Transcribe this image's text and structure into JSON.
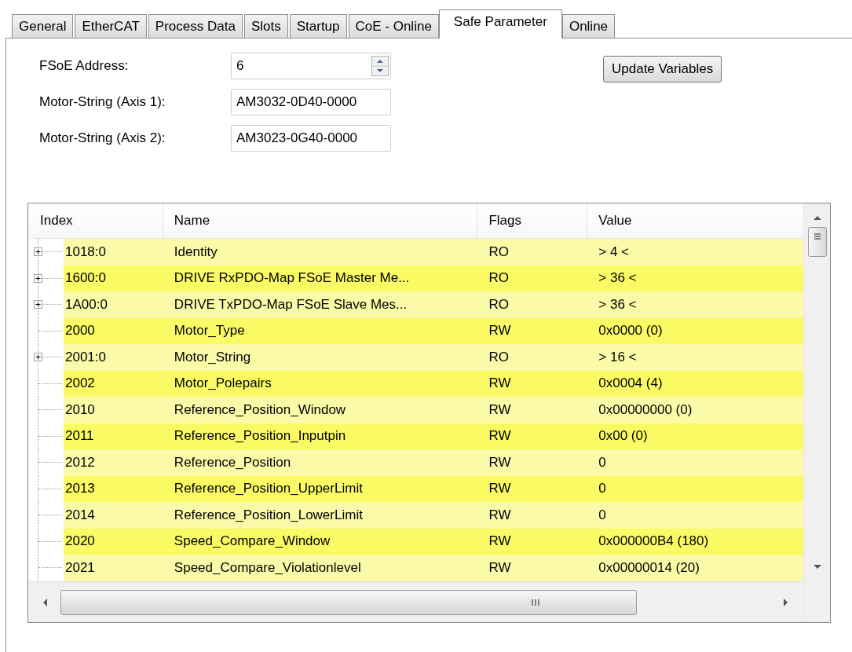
{
  "tabs": [
    {
      "label": "General",
      "selected": false
    },
    {
      "label": "EtherCAT",
      "selected": false
    },
    {
      "label": "Process Data",
      "selected": false
    },
    {
      "label": "Slots",
      "selected": false
    },
    {
      "label": "Startup",
      "selected": false
    },
    {
      "label": "CoE - Online",
      "selected": false
    },
    {
      "label": "Safe Parameter",
      "selected": true
    },
    {
      "label": "Online",
      "selected": false
    }
  ],
  "fields": [
    {
      "kind": "spinner",
      "label": "FSoE Address:",
      "value": "6"
    },
    {
      "kind": "text",
      "label": "Motor-String (Axis 1):",
      "value": "AM3032-0D40-0000"
    },
    {
      "kind": "text",
      "label": "Motor-String (Axis 2):",
      "value": "AM3023-0G40-0000"
    }
  ],
  "update_button": "Update Variables",
  "table": {
    "columns": [
      "Index",
      "Name",
      "Flags",
      "Value"
    ],
    "rows": [
      {
        "kind": "group",
        "expanded": false,
        "cells": [
          "1018:0",
          "Identity",
          "RO",
          "> 4 <"
        ]
      },
      {
        "kind": "group",
        "expanded": false,
        "cells": [
          "1600:0",
          "DRIVE RxPDO-Map FSoE Master Me...",
          "RO",
          "> 36 <"
        ]
      },
      {
        "kind": "group",
        "expanded": false,
        "cells": [
          "1A00:0",
          "DRIVE TxPDO-Map FSoE Slave Mes...",
          "RO",
          "> 36 <"
        ]
      },
      {
        "kind": "item",
        "cells": [
          "2000",
          "Motor_Type",
          "RW",
          "0x0000 (0)"
        ]
      },
      {
        "kind": "group",
        "expanded": false,
        "cells": [
          "2001:0",
          "Motor_String",
          "RO",
          "> 16 <"
        ]
      },
      {
        "kind": "item",
        "cells": [
          "2002",
          "Motor_Polepairs",
          "RW",
          "0x0004 (4)"
        ]
      },
      {
        "kind": "item",
        "cells": [
          "2010",
          "Reference_Position_Window",
          "RW",
          "0x00000000 (0)"
        ]
      },
      {
        "kind": "item",
        "cells": [
          "2011",
          "Reference_Position_Inputpin",
          "RW",
          "0x00 (0)"
        ]
      },
      {
        "kind": "item",
        "cells": [
          "2012",
          "Reference_Position",
          "RW",
          "0"
        ]
      },
      {
        "kind": "item",
        "cells": [
          "2013",
          "Reference_Position_UpperLimit",
          "RW",
          "0"
        ]
      },
      {
        "kind": "item",
        "cells": [
          "2014",
          "Reference_Position_LowerLimit",
          "RW",
          "0"
        ]
      },
      {
        "kind": "item",
        "cells": [
          "2020",
          "Speed_Compare_Window",
          "RW",
          "0x000000B4 (180)"
        ]
      },
      {
        "kind": "item",
        "cells": [
          "2021",
          "Speed_Compare_Violationlevel",
          "RW",
          "0x00000014 (20)"
        ]
      }
    ]
  }
}
